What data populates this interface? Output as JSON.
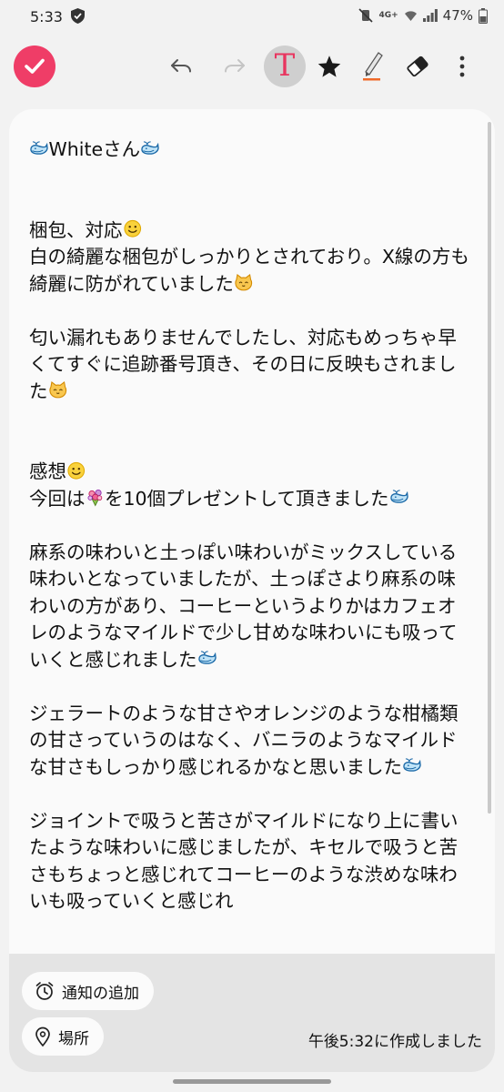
{
  "status_bar": {
    "time": "5:33",
    "battery_pct": "47%",
    "network_label": "4G+"
  },
  "toolbar": {
    "text_tool_glyph": "T",
    "colors": {
      "accent": "#ef3d67",
      "text_tool": "#e8355f",
      "pen_tip": "#f06a2a"
    }
  },
  "note": {
    "lines": [
      "🐳Whiteさん🐳",
      "",
      "",
      "梱包、対応🙂",
      "白の綺麗な梱包がしっかりとされており。X線の方も綺麗に防がれていました🐱",
      "",
      "匂い漏れもありませんでしたし、対応もめっちゃ早くてすぐに追跡番号頂き、その日に反映もされました🐱",
      "",
      "",
      "感想🙂",
      "今回は💐を10個プレゼントして頂きました🐳",
      "",
      "麻系の味わいと土っぽい味わいがミックスしている味わいとなっていましたが、土っぽさより麻系の味わいの方があり、コーヒーというよりかはカフェオレのようなマイルドで少し甘めな味わいにも吸っていくと感じれました🐳",
      "",
      "ジェラートのような甘さやオレンジのような柑橘類の甘さっていうのはなく、バニラのようなマイルドな甘さもしっかり感じれるかなと思いました🐳",
      "",
      "ジョイントで吸うと苦さがマイルドになり上に書いたような味わいに感じましたが、キセルで吸うと苦さもちょっと感じれてコーヒーのような渋めな味わいも吸っていくと感じれ"
    ]
  },
  "bottom": {
    "reminder_label": "通知の追加",
    "location_label": "場所",
    "created_text": "午後5:32に作成しました"
  }
}
